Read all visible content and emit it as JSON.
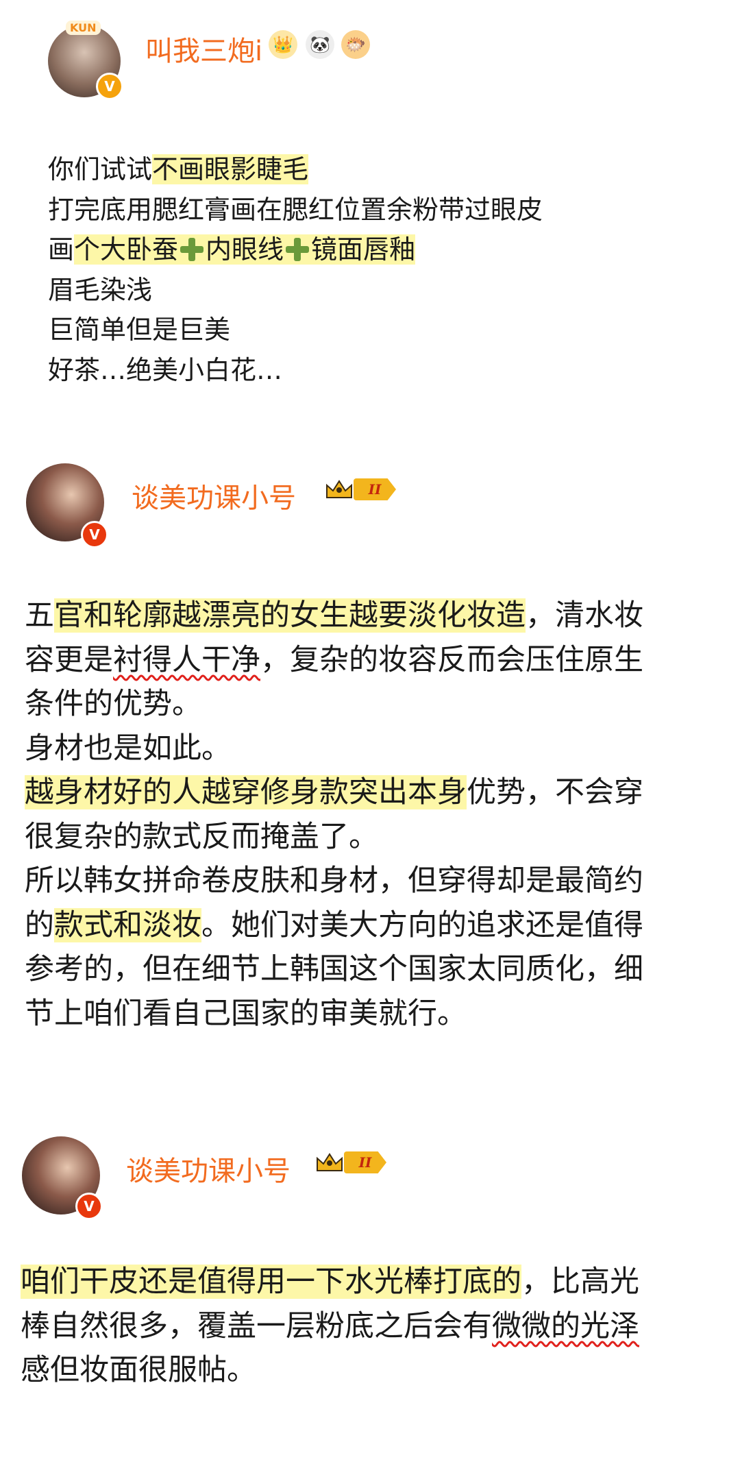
{
  "posts": [
    {
      "username": "叫我三炮i",
      "avatar_tag": "KUN",
      "verified": "V",
      "emojis": [
        "👑",
        "🐼",
        "🐡"
      ],
      "lines": [
        [
          "你们试试",
          "不画眼影睫毛"
        ],
        [
          "打完底用腮红膏画在腮红位置余粉带过眼皮"
        ],
        [
          "画",
          "个大卧蚕",
          "内眼线",
          "镜面唇釉"
        ],
        [
          "眉毛染浅"
        ],
        [
          "巨简单但是巨美"
        ],
        [
          "好茶…绝美小白花…"
        ]
      ]
    },
    {
      "username": "谈美功课小号",
      "verified": "V",
      "level": "II",
      "lines": [
        [
          "五",
          "官和轮廓越漂亮的女生越要淡化妆造",
          "，清水妆"
        ],
        [
          "容更是",
          "衬得人干净",
          "，复杂的妆容反而会压住原生"
        ],
        [
          "条件的优势。"
        ],
        [
          "身材也是如此。"
        ],
        [
          "越身材好的人越穿修身款突出本身",
          "优势，不会穿"
        ],
        [
          "很复杂的款式反而掩盖了。"
        ],
        [
          "所以韩女拼命卷皮肤和身材，但穿得却是最简约"
        ],
        [
          "的",
          "款式和淡妆",
          "。她们对美大方向的追求还是值得"
        ],
        [
          "参考的，但在细节上韩国这个国家太同质化，细"
        ],
        [
          "节上咱们看自己国家的审美就行。"
        ]
      ]
    },
    {
      "username": "谈美功课小号",
      "verified": "V",
      "level": "II",
      "lines": [
        [
          "咱们干皮还是值得用一下水光棒打底的",
          "，比高光"
        ],
        [
          "棒自然很多，覆盖一层粉底之后会有",
          "微微的光泽"
        ],
        [
          "感但妆面很服帖。"
        ]
      ]
    }
  ]
}
